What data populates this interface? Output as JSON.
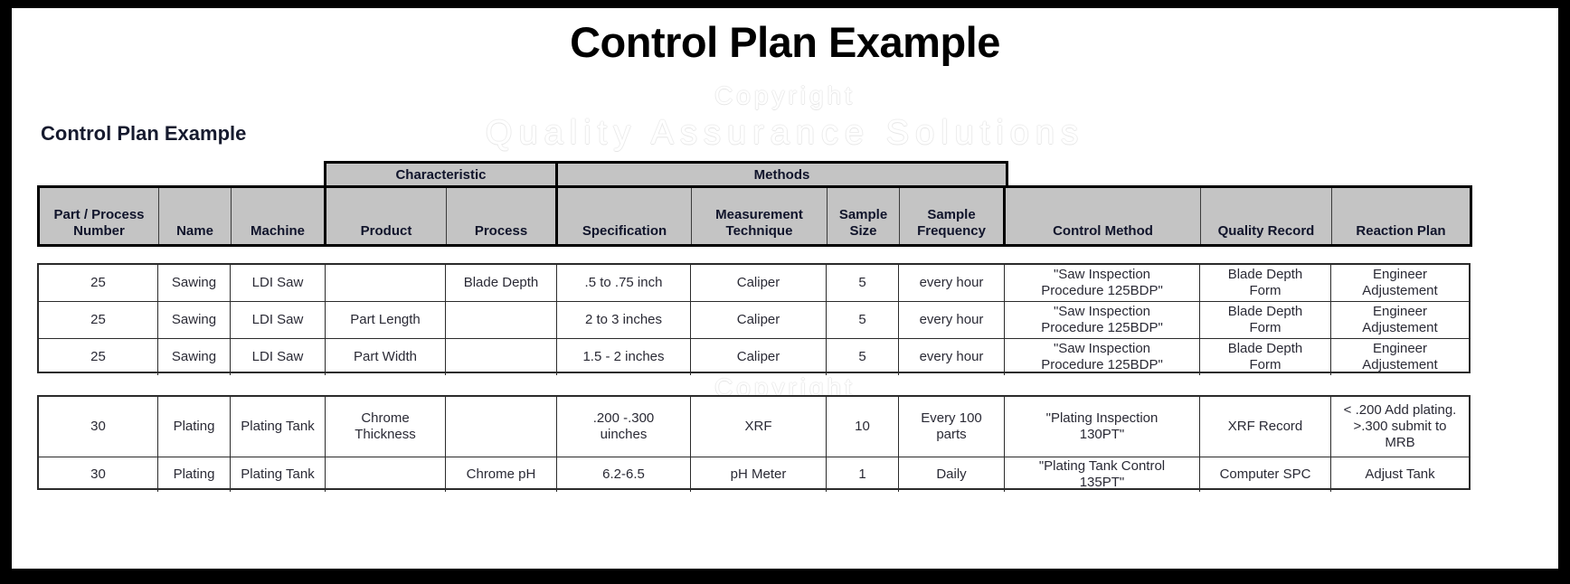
{
  "title": "Control Plan Example",
  "subtitle": "Control Plan Example",
  "watermark": {
    "line1": "Copyright",
    "line2": "Quality Assurance Solutions"
  },
  "table": {
    "group_headers": [
      {
        "label": "Characteristic"
      },
      {
        "label": "Methods"
      }
    ],
    "columns": [
      "Part / Process\nNumber",
      "Name",
      "Machine",
      "Product",
      "Process",
      "Specification",
      "Measurement\nTechnique",
      "Sample\nSize",
      "Sample\nFrequency",
      "Control  Method",
      "Quality Record",
      "Reaction Plan"
    ],
    "columns_display": {
      "c0_l1": "Part / Process",
      "c0_l2": "Number",
      "c1": "Name",
      "c2": "Machine",
      "c3": "Product",
      "c4": "Process",
      "c5": "Specification",
      "c6_l1": "Measurement",
      "c6_l2": "Technique",
      "c7_l1": "Sample",
      "c7_l2": "Size",
      "c8_l1": "Sample",
      "c8_l2": "Frequency",
      "c9": "Control  Method",
      "c10": "Quality Record",
      "c11": "Reaction Plan"
    },
    "groups": [
      {
        "name": "sawing-group",
        "rows": [
          {
            "part_process_number": "25",
            "name": "Sawing",
            "machine": "LDI Saw",
            "product": "",
            "process": "Blade Depth",
            "specification": ".5 to .75 inch",
            "measurement_technique": "Caliper",
            "sample_size": "5",
            "sample_frequency": "every hour",
            "control_method": "\"Saw Inspection\nProcedure 125BDP\"",
            "control_method_l1": "\"Saw Inspection",
            "control_method_l2": "Procedure 125BDP\"",
            "quality_record_l1": "Blade Depth",
            "quality_record_l2": "Form",
            "reaction_plan_l1": "Engineer",
            "reaction_plan_l2": "Adjustement"
          },
          {
            "part_process_number": "25",
            "name": "Sawing",
            "machine": "LDI Saw",
            "product": "Part Length",
            "process": "",
            "specification": "2 to 3 inches",
            "measurement_technique": "Caliper",
            "sample_size": "5",
            "sample_frequency": "every hour",
            "control_method_l1": "\"Saw Inspection",
            "control_method_l2": "Procedure 125BDP\"",
            "quality_record_l1": "Blade Depth",
            "quality_record_l2": "Form",
            "reaction_plan_l1": "Engineer",
            "reaction_plan_l2": "Adjustement"
          },
          {
            "part_process_number": "25",
            "name": "Sawing",
            "machine": "LDI Saw",
            "product": "Part Width",
            "process": "",
            "specification": "1.5 - 2 inches",
            "measurement_technique": "Caliper",
            "sample_size": "5",
            "sample_frequency": "every hour",
            "control_method_l1": "\"Saw Inspection",
            "control_method_l2": "Procedure 125BDP\"",
            "quality_record_l1": "Blade Depth",
            "quality_record_l2": "Form",
            "reaction_plan_l1": "Engineer",
            "reaction_plan_l2": "Adjustement"
          }
        ]
      },
      {
        "name": "plating-group",
        "rows": [
          {
            "part_process_number": "30",
            "name": "Plating",
            "machine": "Plating Tank",
            "product_l1": "Chrome",
            "product_l2": "Thickness",
            "process": "",
            "specification_l1": ".200 -.300",
            "specification_l2": "uinches",
            "measurement_technique": "XRF",
            "sample_size": "10",
            "sample_frequency_l1": "Every 100",
            "sample_frequency_l2": "parts",
            "control_method_l1": "\"Plating Inspection",
            "control_method_l2": "130PT\"",
            "quality_record": "XRF Record",
            "reaction_plan_l1": "< .200 Add plating.",
            "reaction_plan_l2": ">.300 submit to",
            "reaction_plan_l3": "MRB"
          },
          {
            "part_process_number": "30",
            "name": "Plating",
            "machine": "Plating Tank",
            "product": "",
            "process": "Chrome pH",
            "specification": "6.2-6.5",
            "measurement_technique": "pH Meter",
            "sample_size": "1",
            "sample_frequency": "Daily",
            "control_method_l1": "\"Plating Tank Control",
            "control_method_l2": "135PT\"",
            "quality_record": "Computer SPC",
            "reaction_plan": "Adjust Tank"
          }
        ]
      }
    ]
  },
  "colors": {
    "header_fill": "#c4c4c4",
    "border": "#000000",
    "text": "#10142b",
    "page_bg": "#ffffff",
    "frame": "#000000"
  }
}
